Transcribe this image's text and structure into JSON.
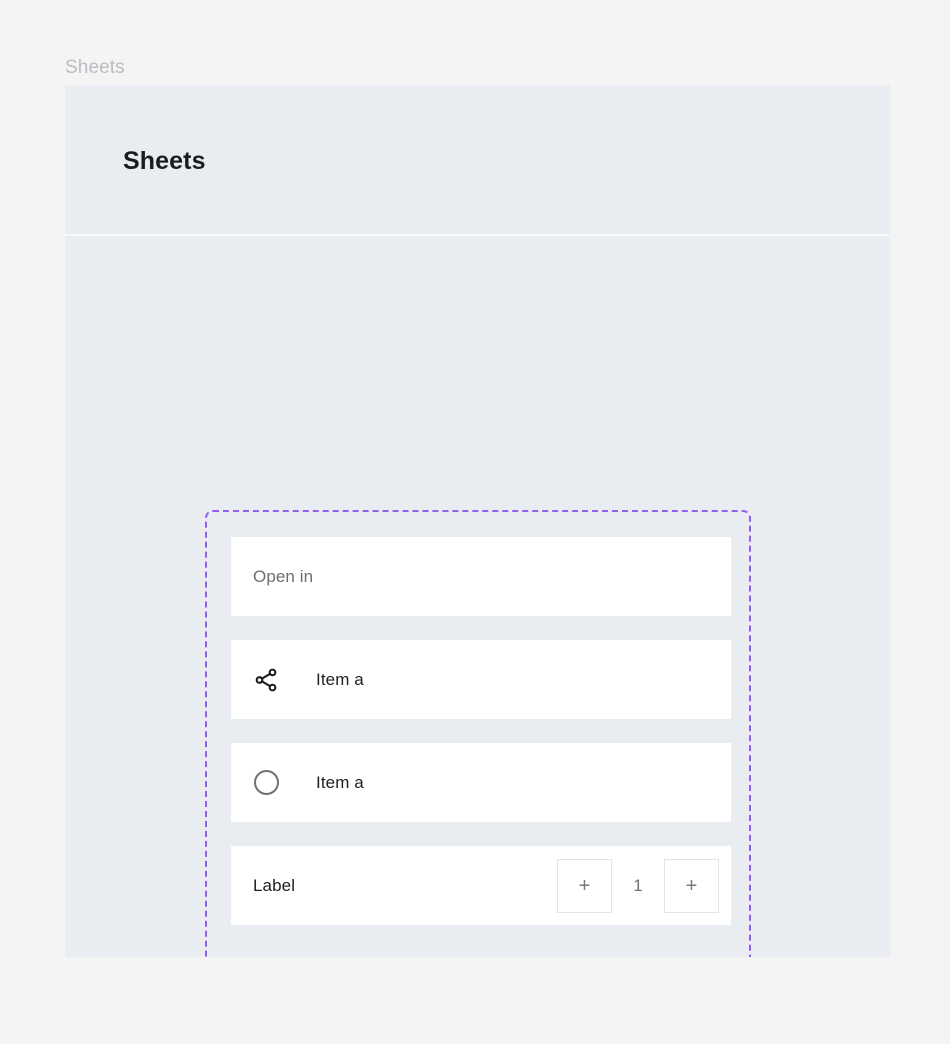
{
  "breadcrumb": {
    "label": "Sheets"
  },
  "panel": {
    "title": "Sheets"
  },
  "colors": {
    "page_background": "#f4f4f4",
    "panel_background": "#e9ecf0",
    "card_background": "#ffffff",
    "selection_outline": "#9160f0",
    "primary_text": "#1e1f21",
    "secondary_text": "#6c6f73",
    "breadcrumb_text": "#b9bdc1",
    "stepper_border": "#e3e4e6"
  },
  "sheet": {
    "cards": [
      {
        "type": "heading",
        "icon": null,
        "label": "Open in"
      },
      {
        "type": "list-item",
        "icon": "share-icon",
        "label": "Item a"
      },
      {
        "type": "radio-item",
        "icon": "radio-unchecked-icon",
        "label": "Item a",
        "checked": false
      },
      {
        "type": "stepper-item",
        "icon": null,
        "label": "Label",
        "stepper": {
          "decrement_label": "+",
          "value": "1",
          "increment_label": "+"
        }
      }
    ]
  }
}
